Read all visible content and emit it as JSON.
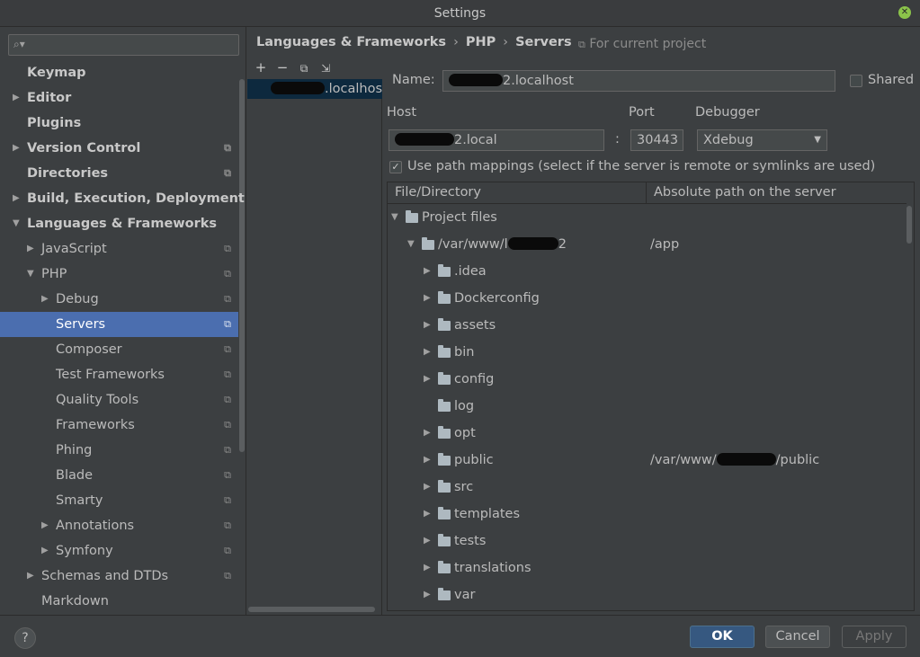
{
  "window": {
    "title": "Settings"
  },
  "search": {
    "placeholder": ""
  },
  "sidebar": {
    "items": [
      {
        "label": "Keymap",
        "bold": true,
        "arrow": "",
        "level": 0,
        "proj": false
      },
      {
        "label": "Editor",
        "bold": true,
        "arrow": "▶",
        "level": 0,
        "proj": false
      },
      {
        "label": "Plugins",
        "bold": true,
        "arrow": "",
        "level": 0,
        "proj": false
      },
      {
        "label": "Version Control",
        "bold": true,
        "arrow": "▶",
        "level": 0,
        "proj": true
      },
      {
        "label": "Directories",
        "bold": true,
        "arrow": "",
        "level": 0,
        "proj": true
      },
      {
        "label": "Build, Execution, Deployment",
        "bold": true,
        "arrow": "▶",
        "level": 0,
        "proj": false
      },
      {
        "label": "Languages & Frameworks",
        "bold": true,
        "arrow": "▼",
        "level": 0,
        "proj": false
      },
      {
        "label": "JavaScript",
        "bold": false,
        "arrow": "▶",
        "level": 1,
        "proj": true
      },
      {
        "label": "PHP",
        "bold": false,
        "arrow": "▼",
        "level": 1,
        "proj": true
      },
      {
        "label": "Debug",
        "bold": false,
        "arrow": "▶",
        "level": 2,
        "proj": true
      },
      {
        "label": "Servers",
        "bold": false,
        "arrow": "",
        "level": 2,
        "proj": true,
        "selected": true
      },
      {
        "label": "Composer",
        "bold": false,
        "arrow": "",
        "level": 2,
        "proj": true
      },
      {
        "label": "Test Frameworks",
        "bold": false,
        "arrow": "",
        "level": 2,
        "proj": true
      },
      {
        "label": "Quality Tools",
        "bold": false,
        "arrow": "",
        "level": 2,
        "proj": true
      },
      {
        "label": "Frameworks",
        "bold": false,
        "arrow": "",
        "level": 2,
        "proj": true
      },
      {
        "label": "Phing",
        "bold": false,
        "arrow": "",
        "level": 2,
        "proj": true
      },
      {
        "label": "Blade",
        "bold": false,
        "arrow": "",
        "level": 2,
        "proj": true
      },
      {
        "label": "Smarty",
        "bold": false,
        "arrow": "",
        "level": 2,
        "proj": true
      },
      {
        "label": "Annotations",
        "bold": false,
        "arrow": "▶",
        "level": 2,
        "proj": true
      },
      {
        "label": "Symfony",
        "bold": false,
        "arrow": "▶",
        "level": 2,
        "proj": true
      },
      {
        "label": "Schemas and DTDs",
        "bold": false,
        "arrow": "▶",
        "level": 1,
        "proj": true
      },
      {
        "label": "Markdown",
        "bold": false,
        "arrow": "",
        "level": 1,
        "proj": false
      }
    ]
  },
  "breadcrumb": {
    "parts": [
      "Languages & Frameworks",
      "PHP",
      "Servers"
    ],
    "separator": "›"
  },
  "scope": {
    "label": "For current project"
  },
  "servers": {
    "items": [
      {
        "label": ".localhost"
      }
    ]
  },
  "form": {
    "name_label": "Name:",
    "name_value": "2.localhost",
    "shared_label": "Shared",
    "host_label": "Host",
    "host_value": "2.local",
    "port_label": "Port",
    "port_sep": ":",
    "port_value": "30443",
    "debugger_label": "Debugger",
    "debugger_value": "Xdebug",
    "path_mappings_label": "Use path mappings (select if the server is remote or symlinks are used)"
  },
  "mapping": {
    "col_file": "File/Directory",
    "col_server": "Absolute path on the server",
    "rows": [
      {
        "name": "Project files",
        "arrow": "▼",
        "level": 0,
        "path": ""
      },
      {
        "name": "/var/www/l",
        "suffix": "2",
        "arrow": "▼",
        "level": 1,
        "path": "/app"
      },
      {
        "name": ".idea",
        "arrow": "▶",
        "level": 2,
        "path": ""
      },
      {
        "name": "Dockerconfig",
        "arrow": "▶",
        "level": 2,
        "path": ""
      },
      {
        "name": "assets",
        "arrow": "▶",
        "level": 2,
        "path": ""
      },
      {
        "name": "bin",
        "arrow": "▶",
        "level": 2,
        "path": ""
      },
      {
        "name": "config",
        "arrow": "▶",
        "level": 2,
        "path": ""
      },
      {
        "name": "log",
        "arrow": "",
        "level": 2,
        "path": ""
      },
      {
        "name": "opt",
        "arrow": "▶",
        "level": 2,
        "path": ""
      },
      {
        "name": "public",
        "arrow": "▶",
        "level": 2,
        "path": "/var/www/",
        "path_suffix": "/public"
      },
      {
        "name": "src",
        "arrow": "▶",
        "level": 2,
        "path": ""
      },
      {
        "name": "templates",
        "arrow": "▶",
        "level": 2,
        "path": ""
      },
      {
        "name": "tests",
        "arrow": "▶",
        "level": 2,
        "path": ""
      },
      {
        "name": "translations",
        "arrow": "▶",
        "level": 2,
        "path": ""
      },
      {
        "name": "var",
        "arrow": "▶",
        "level": 2,
        "path": ""
      }
    ]
  },
  "footer": {
    "help": "?",
    "ok": "OK",
    "cancel": "Cancel",
    "apply": "Apply"
  },
  "colors": {
    "selection": "#4b6eaf",
    "background": "#3c3f41",
    "ok_button": "#365880"
  },
  "icons": {
    "close": "close-icon",
    "search": "search-icon",
    "project_scope": "project-scope-icon",
    "folder": "folder-icon"
  }
}
